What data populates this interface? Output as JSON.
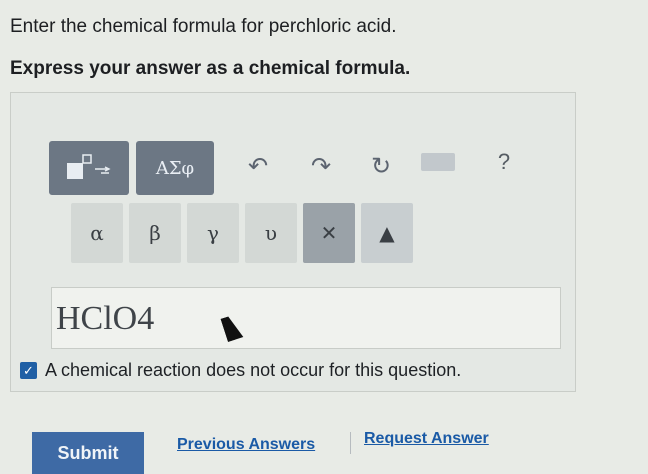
{
  "question": {
    "prompt": "Enter the chemical formula for perchloric acid.",
    "instruction": "Express your answer as a chemical formula."
  },
  "toolbar": {
    "greek_toggle_label": "ΑΣφ",
    "undo_icon": "↶",
    "redo_icon": "↷",
    "reset_icon": "↻",
    "help_label": "?"
  },
  "keypad": {
    "keys": [
      "α",
      "β",
      "γ",
      "υ"
    ],
    "delete_label": "✕",
    "arrow_label": "▲"
  },
  "answer": {
    "value": "HClO4"
  },
  "checkbox": {
    "label": "A chemical reaction does not occur for this question.",
    "checked": true
  },
  "actions": {
    "submit_label": "Submit",
    "previous_answers_label": "Previous Answers",
    "request_answer_label": "Request Answer"
  },
  "colors": {
    "button_dark": "#6c7784",
    "submit_blue": "#3e6aa5",
    "link_blue": "#1a5aa6"
  }
}
